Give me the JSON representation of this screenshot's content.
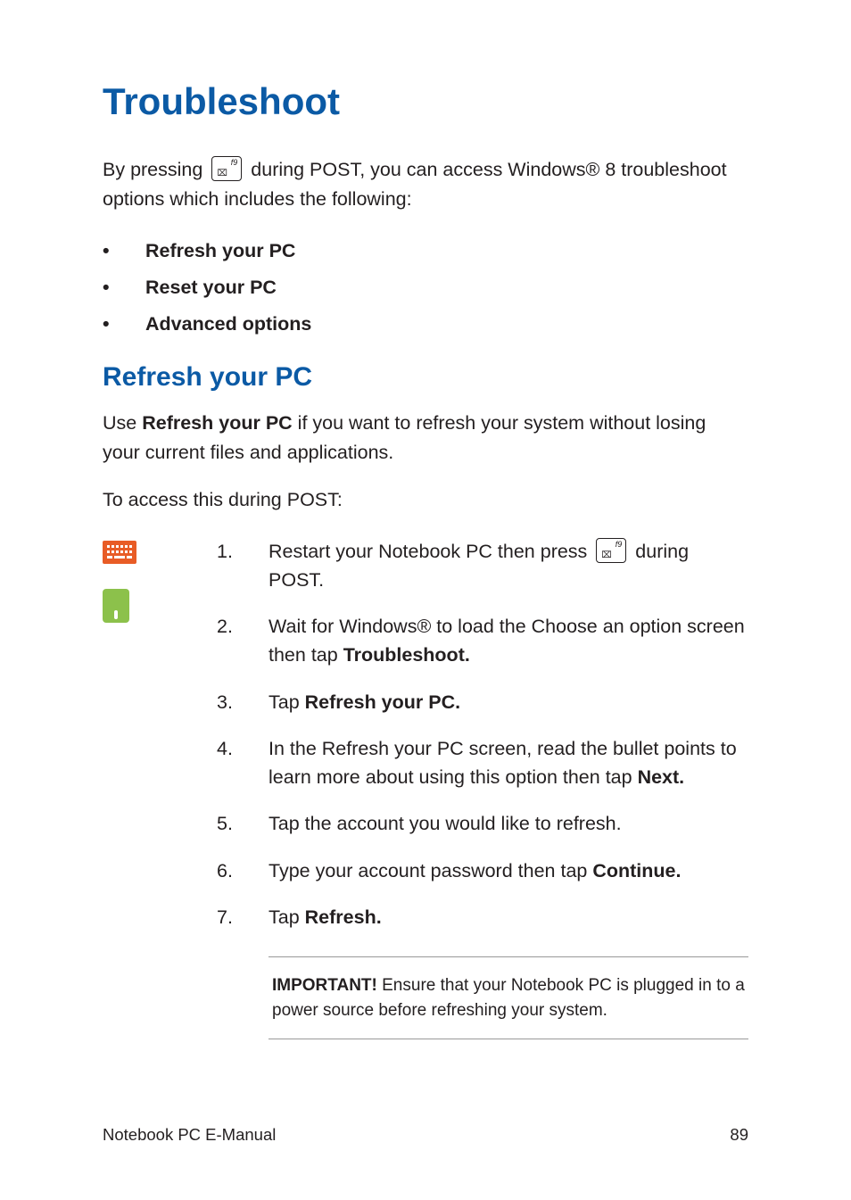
{
  "heading": "Troubleshoot",
  "intro_before": "By pressing ",
  "intro_after": " during POST, you can access Windows® 8 troubleshoot options which includes the following:",
  "key_f9_sub": "⌧",
  "key_f9_sup": "f9",
  "options": [
    "Refresh your PC",
    "Reset your PC",
    "Advanced options"
  ],
  "section_heading": "Refresh your PC",
  "section_intro_before": "Use ",
  "section_intro_bold": "Refresh your PC",
  "section_intro_after": " if you want to refresh your system without losing your current files and applications.",
  "access_label": "To access this during POST:",
  "steps": {
    "s1": {
      "num": "1.",
      "before": "Restart your Notebook PC then press ",
      "after": " during POST."
    },
    "s2": {
      "num": "2.",
      "before": "Wait for Windows® to load the Choose an option screen then tap ",
      "bold": "Troubleshoot."
    },
    "s3": {
      "num": "3.",
      "before": "Tap ",
      "bold": "Refresh your PC."
    },
    "s4": {
      "num": "4.",
      "before": "In the Refresh your PC screen, read the bullet points to learn more about using this option then tap ",
      "bold": "Next."
    },
    "s5": {
      "num": "5.",
      "text": "Tap the account you would like to refresh."
    },
    "s6": {
      "num": "6.",
      "before": "Type your account password then tap ",
      "bold": "Continue."
    },
    "s7": {
      "num": "7.",
      "before": "Tap ",
      "bold": "Refresh."
    }
  },
  "note_bold": "IMPORTANT!",
  "note_text": " Ensure that your Notebook PC is plugged in to a power source before refreshing your system.",
  "footer_left": "Notebook PC E-Manual",
  "footer_right": "89"
}
